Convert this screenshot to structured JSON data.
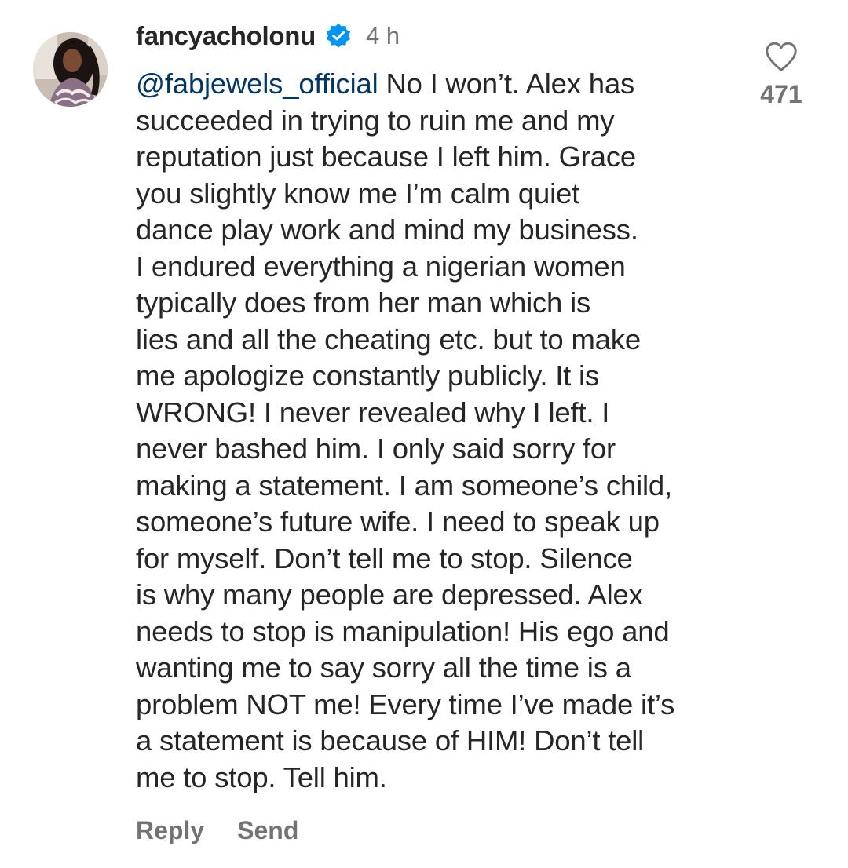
{
  "comment": {
    "username": "fancyacholonu",
    "verified_icon": "verified-badge-icon",
    "timestamp": "4 h",
    "mention": "@fabjewels_official",
    "lines": [
      " No I won’t. Alex has",
      "succeeded in trying to ruin me and my",
      "reputation just because I left him. Grace",
      "you slightly know me I’m calm quiet",
      "dance play work and mind my business.",
      "I endured everything a nigerian women",
      "typically does from her man which is",
      "lies and all the cheating etc. but to make",
      "me apologize constantly publicly. It is",
      "WRONG! I never revealed why I left. I",
      "never bashed him. I only said sorry for",
      "making a statement. I am someone’s child,",
      "someone’s future wife. I need to speak up",
      "for myself. Don’t tell me to stop. Silence",
      "is why many people are depressed. Alex",
      "needs to stop is manipulation! His ego and",
      "wanting me to say sorry all the time is a",
      "problem NOT me! Every time I’ve made it’s",
      "a statement is because of HIM! Don’t tell",
      "me to stop. Tell him."
    ],
    "reply_label": "Reply",
    "send_label": "Send",
    "like_icon": "heart-outline-icon",
    "like_count": "471"
  },
  "colors": {
    "text": "#262626",
    "secondary": "#737373",
    "mention": "#00376b",
    "verified": "#0095f6"
  }
}
